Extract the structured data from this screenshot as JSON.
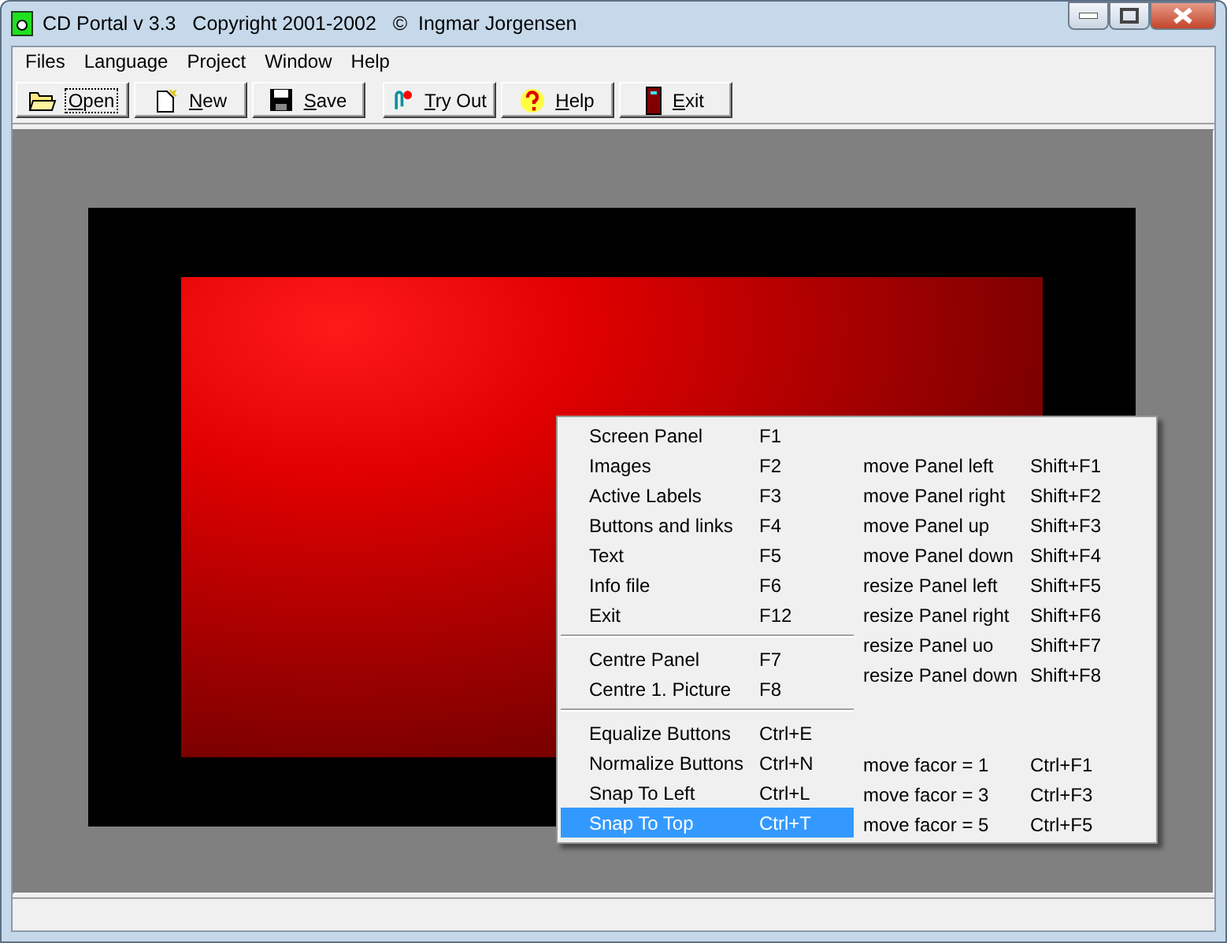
{
  "window": {
    "title": "CD Portal v 3.3   Copyright 2001-2002   ©  Ingmar Jorgensen"
  },
  "menu_bar": [
    "Files",
    "Language",
    "Project",
    "Window",
    "Help"
  ],
  "toolbar": [
    {
      "label": "Open",
      "focused": true
    },
    {
      "label": "New",
      "focused": false
    },
    {
      "label": "Save",
      "focused": false
    },
    {
      "label": "Try Out",
      "focused": false
    },
    {
      "label": "Help",
      "focused": false
    },
    {
      "label": "Exit",
      "focused": false
    }
  ],
  "context_menu": {
    "left": [
      {
        "kind": "item",
        "label": "Screen  Panel",
        "shortcut": "F1",
        "selected": false
      },
      {
        "kind": "item",
        "label": "Images",
        "shortcut": "F2",
        "selected": false
      },
      {
        "kind": "item",
        "label": "Active Labels",
        "shortcut": "F3",
        "selected": false
      },
      {
        "kind": "item",
        "label": "Buttons and links",
        "shortcut": "F4",
        "selected": false
      },
      {
        "kind": "item",
        "label": "Text",
        "shortcut": "F5",
        "selected": false
      },
      {
        "kind": "item",
        "label": "Info file",
        "shortcut": "F6",
        "selected": false
      },
      {
        "kind": "item",
        "label": "Exit",
        "shortcut": "F12",
        "selected": false
      },
      {
        "kind": "separator"
      },
      {
        "kind": "item",
        "label": "Centre Panel",
        "shortcut": "F7",
        "selected": false
      },
      {
        "kind": "item",
        "label": "Centre 1. Picture",
        "shortcut": "F8",
        "selected": false
      },
      {
        "kind": "separator"
      },
      {
        "kind": "item",
        "label": "Equalize Buttons",
        "shortcut": "Ctrl+E",
        "selected": false
      },
      {
        "kind": "item",
        "label": "Normalize Buttons",
        "shortcut": "Ctrl+N",
        "selected": false
      },
      {
        "kind": "item",
        "label": "Snap To Left",
        "shortcut": "Ctrl+L",
        "selected": false
      },
      {
        "kind": "item",
        "label": "Snap To Top",
        "shortcut": "Ctrl+T",
        "selected": true
      }
    ],
    "right": [
      {
        "kind": "gap"
      },
      {
        "kind": "item",
        "label": "move Panel left",
        "shortcut": "Shift+F1"
      },
      {
        "kind": "item",
        "label": "move Panel right",
        "shortcut": "Shift+F2"
      },
      {
        "kind": "item",
        "label": "move Panel up",
        "shortcut": "Shift+F3"
      },
      {
        "kind": "item",
        "label": "move Panel down",
        "shortcut": "Shift+F4"
      },
      {
        "kind": "item",
        "label": "resize Panel left",
        "shortcut": "Shift+F5"
      },
      {
        "kind": "item",
        "label": "resize Panel right",
        "shortcut": "Shift+F6"
      },
      {
        "kind": "item",
        "label": "resize Panel uo",
        "shortcut": "Shift+F7"
      },
      {
        "kind": "item",
        "label": "resize Panel down",
        "shortcut": "Shift+F8"
      },
      {
        "kind": "gap"
      },
      {
        "kind": "gap"
      },
      {
        "kind": "item",
        "label": "move facor = 1",
        "shortcut": "Ctrl+F1"
      },
      {
        "kind": "item",
        "label": "move facor = 3",
        "shortcut": "Ctrl+F3"
      },
      {
        "kind": "item",
        "label": "move facor = 5",
        "shortcut": "Ctrl+F5"
      }
    ]
  }
}
